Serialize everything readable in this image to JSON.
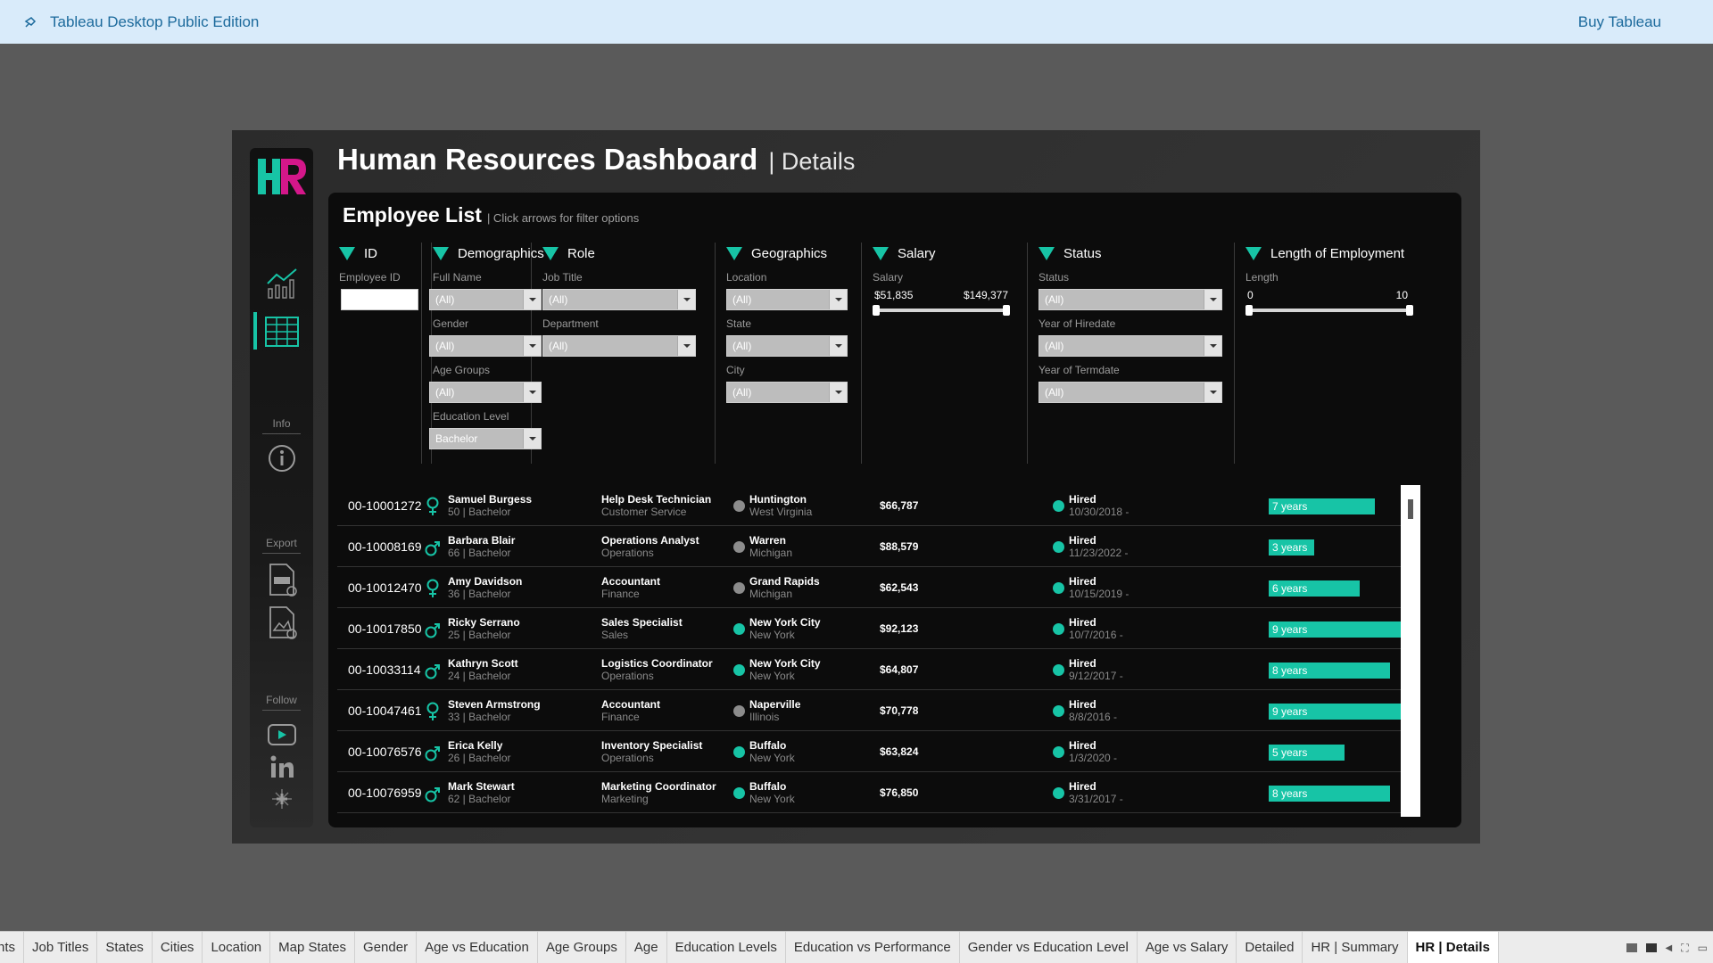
{
  "app": {
    "title": "Tableau Desktop Public Edition",
    "buy_label": "Buy Tableau"
  },
  "dashboard": {
    "title": "Human Resources Dashboard",
    "subtitle": "| Details"
  },
  "sidebar": {
    "info_label": "Info",
    "export_label": "Export",
    "follow_label": "Follow",
    "logo_text": "HR"
  },
  "panel": {
    "title": "Employee List",
    "hint": "| Click arrows for filter options"
  },
  "filters": {
    "id": {
      "header": "ID",
      "label": "Employee ID"
    },
    "demographics": {
      "header": "Demographics",
      "full_name_label": "Full Name",
      "full_name": "(All)",
      "gender_label": "Gender",
      "gender": "(All)",
      "age_groups_label": "Age Groups",
      "age_groups": "(All)",
      "education_label": "Education Level",
      "education": "Bachelor"
    },
    "role": {
      "header": "Role",
      "job_title_label": "Job Title",
      "job_title": "(All)",
      "department_label": "Department",
      "department": "(All)"
    },
    "geographics": {
      "header": "Geographics",
      "location_label": "Location",
      "location": "(All)",
      "state_label": "State",
      "state": "(All)",
      "city_label": "City",
      "city": "(All)"
    },
    "salary": {
      "header": "Salary",
      "label": "Salary",
      "min": "$51,835",
      "max": "$149,377"
    },
    "status": {
      "header": "Status",
      "status_label": "Status",
      "status": "(All)",
      "hire_label": "Year of Hiredate",
      "hire": "(All)",
      "term_label": "Year of Termdate",
      "term": "(All)"
    },
    "length": {
      "header": "Length of Employment",
      "label": "Length",
      "min": "0",
      "max": "10"
    }
  },
  "colors": {
    "accent": "#17c4a6",
    "gray_dot": "#8c8c8c"
  },
  "employees": [
    {
      "id": "00-10001272",
      "name": "Samuel Burgess",
      "meta": "50  |  Bachelor",
      "gender": "female",
      "title": "Help Desk Technician",
      "dept": "Customer Service",
      "city": "Huntington",
      "state": "West Virginia",
      "loc": "gray",
      "salary": "$66,787",
      "status": "Hired",
      "date": "10/30/2018 -",
      "length": "7 years",
      "years": 7
    },
    {
      "id": "00-10008169",
      "name": "Barbara Blair",
      "meta": "66  |  Bachelor",
      "gender": "male",
      "title": "Operations Analyst",
      "dept": "Operations",
      "city": "Warren",
      "state": "Michigan",
      "loc": "gray",
      "salary": "$88,579",
      "status": "Hired",
      "date": "11/23/2022 -",
      "length": "3 years",
      "years": 3
    },
    {
      "id": "00-10012470",
      "name": "Amy Davidson",
      "meta": "36  |  Bachelor",
      "gender": "female",
      "title": "Accountant",
      "dept": "Finance",
      "city": "Grand Rapids",
      "state": "Michigan",
      "loc": "gray",
      "salary": "$62,543",
      "status": "Hired",
      "date": "10/15/2019 -",
      "length": "6 years",
      "years": 6
    },
    {
      "id": "00-10017850",
      "name": "Ricky Serrano",
      "meta": "25  |  Bachelor",
      "gender": "male",
      "title": "Sales Specialist",
      "dept": "Sales",
      "city": "New York City",
      "state": "New York",
      "loc": "teal",
      "salary": "$92,123",
      "status": "Hired",
      "date": "10/7/2016 -",
      "length": "9 years",
      "years": 9
    },
    {
      "id": "00-10033114",
      "name": "Kathryn Scott",
      "meta": "24  |  Bachelor",
      "gender": "male",
      "title": "Logistics Coordinator",
      "dept": "Operations",
      "city": "New York City",
      "state": "New York",
      "loc": "teal",
      "salary": "$64,807",
      "status": "Hired",
      "date": "9/12/2017 -",
      "length": "8 years",
      "years": 8
    },
    {
      "id": "00-10047461",
      "name": "Steven Armstrong",
      "meta": "33  |  Bachelor",
      "gender": "female",
      "title": "Accountant",
      "dept": "Finance",
      "city": "Naperville",
      "state": "Illinois",
      "loc": "gray",
      "salary": "$70,778",
      "status": "Hired",
      "date": "8/8/2016 -",
      "length": "9 years",
      "years": 9
    },
    {
      "id": "00-10076576",
      "name": "Erica Kelly",
      "meta": "26  |  Bachelor",
      "gender": "male",
      "title": "Inventory Specialist",
      "dept": "Operations",
      "city": "Buffalo",
      "state": "New York",
      "loc": "teal",
      "salary": "$63,824",
      "status": "Hired",
      "date": "1/3/2020 -",
      "length": "5 years",
      "years": 5
    },
    {
      "id": "00-10076959",
      "name": "Mark Stewart",
      "meta": "62  |  Bachelor",
      "gender": "male",
      "title": "Marketing Coordinator",
      "dept": "Marketing",
      "city": "Buffalo",
      "state": "New York",
      "loc": "teal",
      "salary": "$76,850",
      "status": "Hired",
      "date": "3/31/2017 -",
      "length": "8 years",
      "years": 8
    }
  ],
  "tabs": [
    "rtments",
    "Job Titles",
    "States",
    "Cities",
    "Location",
    "Map States",
    "Gender",
    "Age vs Education",
    "Age Groups",
    "Age",
    "Education Levels",
    "Education vs Performance",
    "Gender vs Education Level",
    "Age vs Salary",
    "Detailed",
    "HR | Summary",
    "HR | Details"
  ],
  "active_tab": "HR | Details"
}
